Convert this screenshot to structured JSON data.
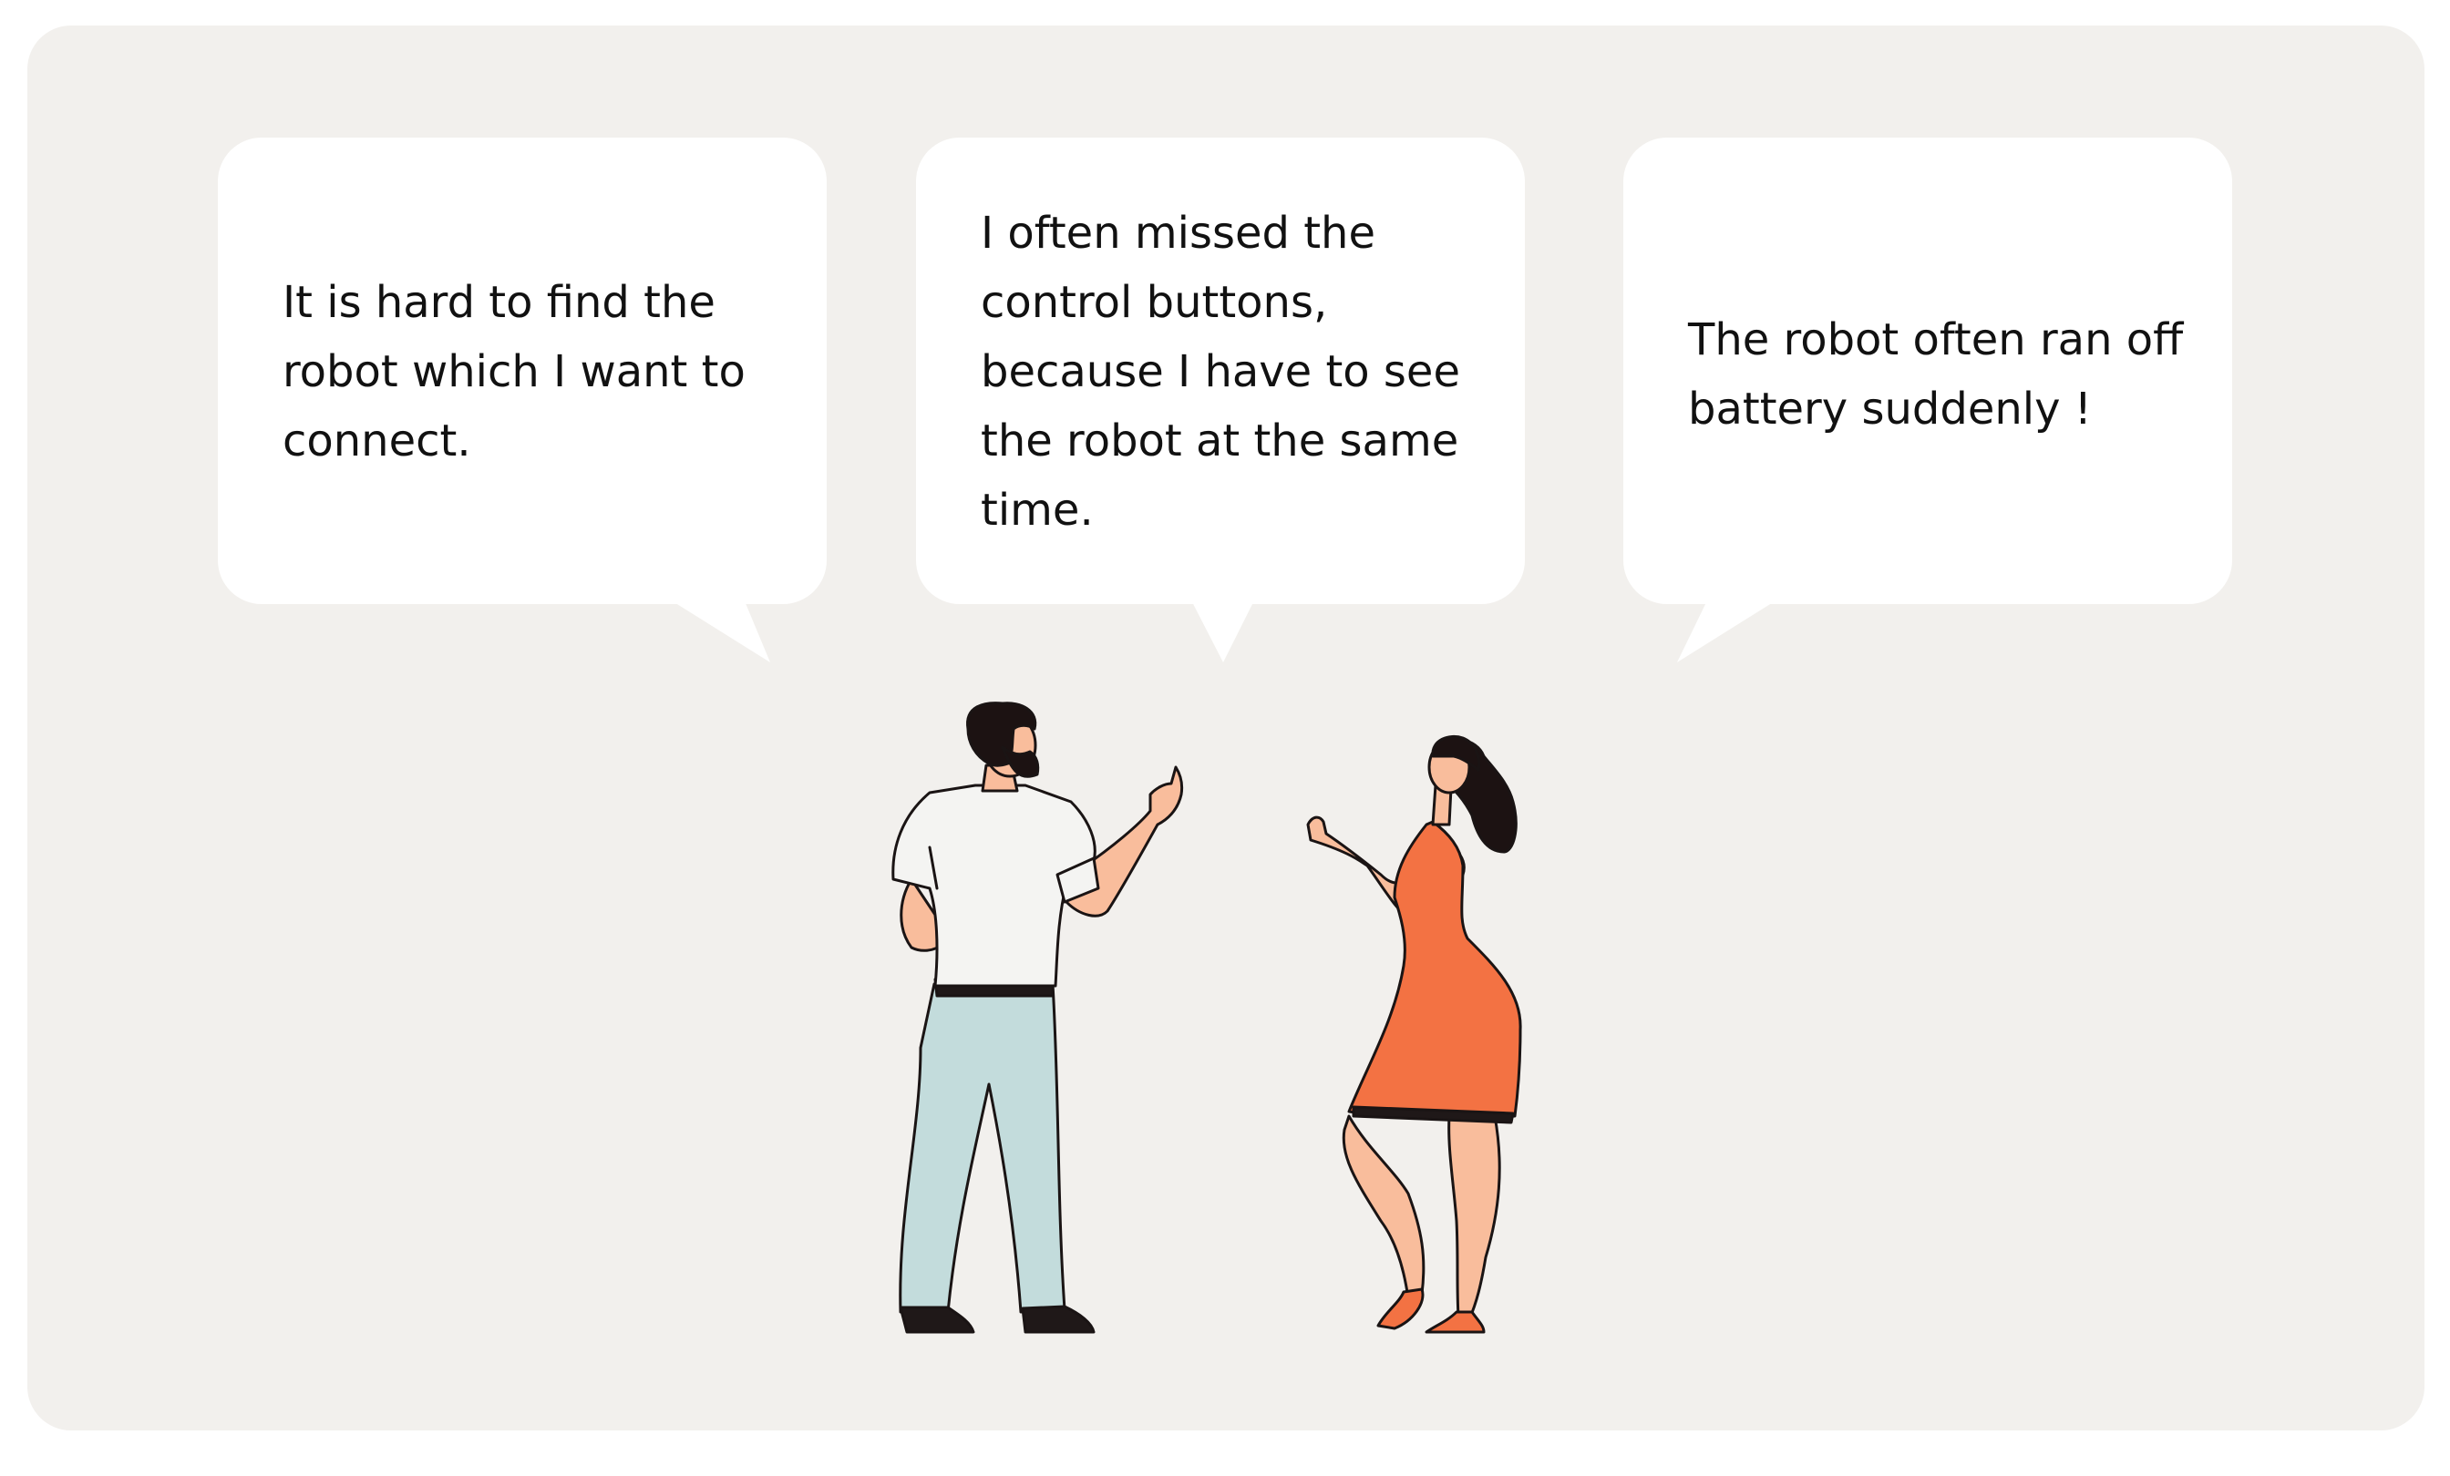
{
  "colors": {
    "background": "#f2f0ed",
    "bubble": "#ffffff",
    "text": "#111111",
    "outline": "#1a1414",
    "hair": "#1c1212",
    "skin": "#f9bd9c",
    "shirt": "#f4f4f2",
    "pants": "#c3dcdc",
    "dress": "#f37243",
    "shoes": "#1f1818"
  },
  "bubbles": [
    {
      "text": "It is hard to find the\nrobot which I want to\nconnect."
    },
    {
      "text": "I often missed the\ncontrol buttons,\nbecause I have to see\nthe robot at the same\ntime."
    },
    {
      "text": "The robot often ran off\nbattery suddenly !"
    }
  ]
}
